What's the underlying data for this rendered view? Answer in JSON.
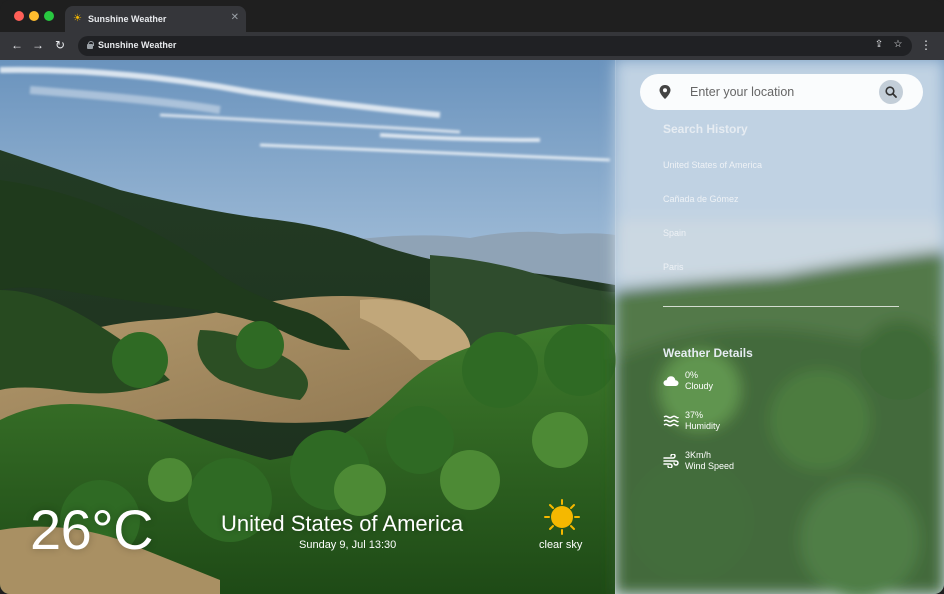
{
  "browser": {
    "tab_title": "Sunshine Weather",
    "url": "Sunshine Weather",
    "tab_icon": "sun-icon"
  },
  "search": {
    "placeholder": "Enter your location"
  },
  "history": {
    "title": "Search History",
    "items": [
      "United States of America",
      "Cañada de Gómez",
      "Spain",
      "Paris"
    ]
  },
  "details": {
    "title": "Weather Details",
    "cloud": {
      "value": "0%",
      "label": "Cloudy",
      "icon": "cloud-icon"
    },
    "humidity": {
      "value": "37%",
      "label": "Humidity",
      "icon": "humidity-icon"
    },
    "wind": {
      "value": "3Km/h",
      "label": "Wind Speed",
      "icon": "wind-icon"
    }
  },
  "current": {
    "temperature": "26°C",
    "location": "United States of America",
    "datetime": "Sunday 9, Jul 13:30",
    "condition": "clear sky",
    "condition_icon": "sun-icon"
  },
  "colors": {
    "sun": "#f5b800",
    "panel_tint": "rgba(255,255,255,0.10)"
  }
}
